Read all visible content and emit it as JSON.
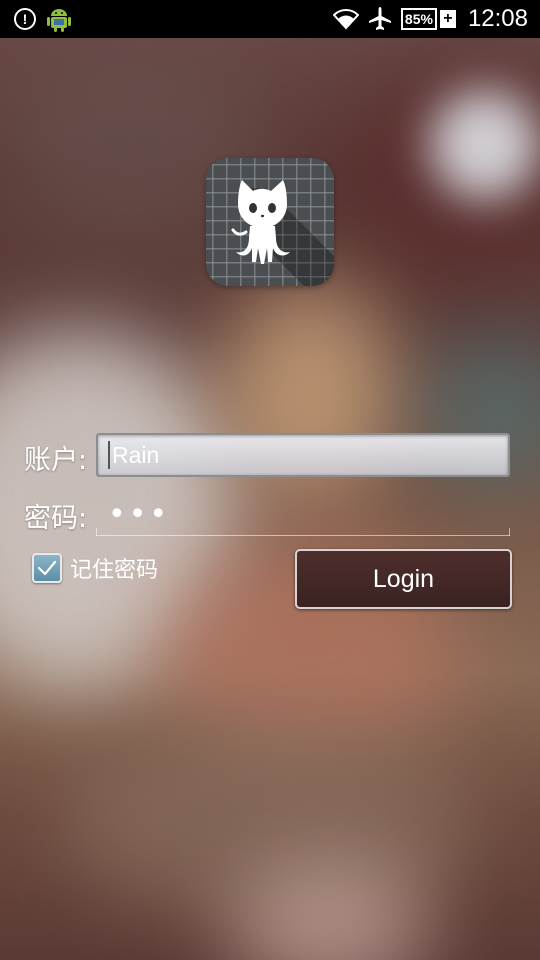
{
  "status_bar": {
    "alert_icon": "alert-circle-icon",
    "app_icon": "android-icon",
    "wifi_icon": "wifi-icon",
    "airplane_icon": "airplane-icon",
    "battery_level": "85%",
    "battery_plus": "+",
    "time": "12:08"
  },
  "logo": {
    "icon": "octocat-icon"
  },
  "form": {
    "account_label": "账户:",
    "account_value": "Rain",
    "password_label": "密码:",
    "password_mask": "•••",
    "remember_label": "记住密码",
    "remember_checked": true,
    "login_label": "Login"
  },
  "colors": {
    "button_bg": "#452a27",
    "checkbox_fill": "#6f9fb6",
    "status_bar_bg": "#000000"
  }
}
